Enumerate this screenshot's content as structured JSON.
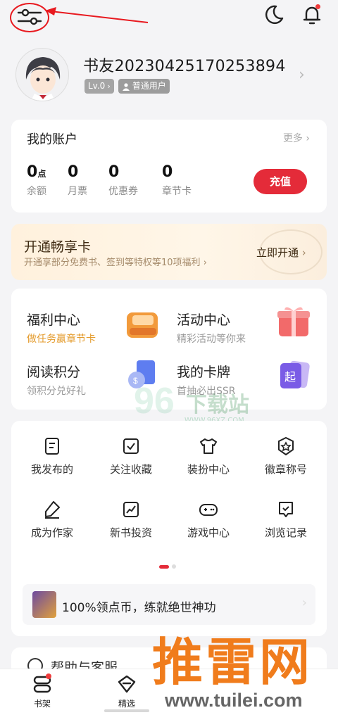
{
  "top_bar": {
    "settings_icon": "sliders-icon",
    "moon_icon": "moon-icon",
    "bell_icon": "bell-icon"
  },
  "profile": {
    "username": "书友20230425170253894",
    "level": "Lv.0",
    "role": "普通用户"
  },
  "account": {
    "title": "我的账户",
    "more": "更多",
    "balance_value": "0",
    "balance_unit": "点",
    "balance_label": "余额",
    "monthly_value": "0",
    "monthly_label": "月票",
    "coupon_value": "0",
    "coupon_label": "优惠券",
    "chapter_value": "0",
    "chapter_label": "章节卡",
    "recharge": "充值"
  },
  "vip": {
    "title": "开通畅享卡",
    "subtitle": "开通享部分免费书、签到等特权等10项福利",
    "cta": "立即开通"
  },
  "features": [
    {
      "title": "福利中心",
      "subtitle": "做任务赢章节卡"
    },
    {
      "title": "活动中心",
      "subtitle": "精彩活动等你来"
    },
    {
      "title": "阅读积分",
      "subtitle": "领积分兑好礼"
    },
    {
      "title": "我的卡牌",
      "subtitle": "首抽必出SSR"
    }
  ],
  "grid": [
    {
      "label": "我发布的",
      "icon": "document-icon"
    },
    {
      "label": "关注收藏",
      "icon": "bookmark-check-icon"
    },
    {
      "label": "装扮中心",
      "icon": "tshirt-icon"
    },
    {
      "label": "徽章称号",
      "icon": "badge-star-icon"
    },
    {
      "label": "成为作家",
      "icon": "pen-icon"
    },
    {
      "label": "新书投资",
      "icon": "trend-chart-icon"
    },
    {
      "label": "游戏中心",
      "icon": "gamepad-icon"
    },
    {
      "label": "浏览记录",
      "icon": "history-icon"
    }
  ],
  "promo": {
    "text": "100%领点币，练就绝世神功"
  },
  "help": {
    "text": "帮助与客服"
  },
  "tabs": [
    {
      "label": "书架",
      "icon": "bookshelf-icon"
    },
    {
      "label": "精选",
      "icon": "diamond-icon"
    }
  ],
  "watermarks": {
    "site1_num": "96",
    "site1_name": "下载站",
    "site1_url": "WWW.96XZ.COM",
    "site2_name": "推雷网",
    "site2_url": "www.tuilei.com"
  },
  "colors": {
    "accent": "#e42b39",
    "gold": "#e49b2c",
    "annotation": "#e8191f"
  }
}
